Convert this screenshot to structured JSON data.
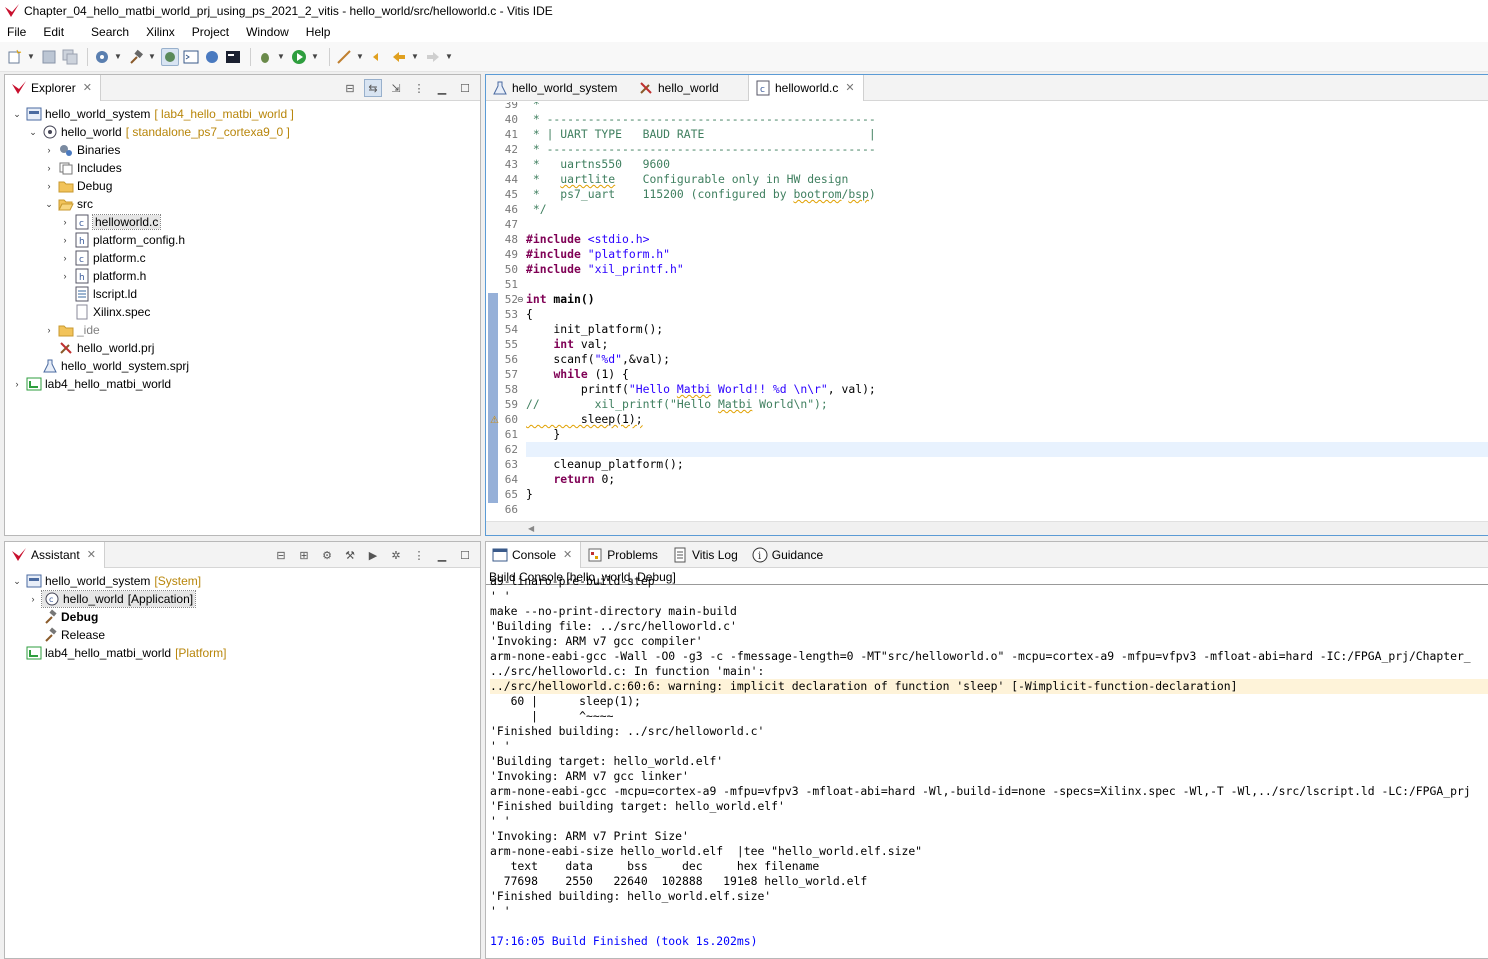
{
  "window": {
    "title": "Chapter_04_hello_matbi_world_prj_using_ps_2021_2_vitis - hello_world/src/helloworld.c - Vitis IDE"
  },
  "menu": [
    "File",
    "Edit",
    "Search",
    "Xilinx",
    "Project",
    "Window",
    "Help"
  ],
  "colors": {
    "accent": "#5b9bd5",
    "warning_bg": "#fef3d9",
    "comment": "#3f7f5f",
    "keyword": "#7f0055",
    "string": "#2a00ff",
    "deco_text": "#b8860b"
  },
  "explorer": {
    "tab_label": "Explorer",
    "items": [
      {
        "label": "hello_world_system",
        "deco": "[ lab4_hello_matbi_world ]",
        "icon": "system-project-icon"
      },
      {
        "label": "hello_world",
        "deco": "[ standalone_ps7_cortexa9_0 ]",
        "icon": "application-project-icon"
      },
      {
        "label": "Binaries",
        "icon": "binaries-icon"
      },
      {
        "label": "Includes",
        "icon": "includes-icon"
      },
      {
        "label": "Debug",
        "icon": "folder-icon"
      },
      {
        "label": "src",
        "icon": "folder-open-icon"
      },
      {
        "label": "helloworld.c",
        "icon": "c-file-icon"
      },
      {
        "label": "platform_config.h",
        "icon": "h-file-icon"
      },
      {
        "label": "platform.c",
        "icon": "c-file-icon"
      },
      {
        "label": "platform.h",
        "icon": "h-file-icon"
      },
      {
        "label": "lscript.ld",
        "icon": "linker-script-icon"
      },
      {
        "label": "Xilinx.spec",
        "icon": "file-icon"
      },
      {
        "label": "_ide",
        "icon": "folder-icon"
      },
      {
        "label": "hello_world.prj",
        "icon": "prj-file-icon"
      },
      {
        "label": "hello_world_system.sprj",
        "icon": "sprj-file-icon"
      },
      {
        "label": "lab4_hello_matbi_world",
        "icon": "platform-project-icon"
      }
    ]
  },
  "assistant": {
    "tab_label": "Assistant",
    "items": [
      {
        "label": "hello_world_system",
        "deco": "[System]"
      },
      {
        "label": "hello_world",
        "deco": "[Application]"
      },
      {
        "label": "Debug"
      },
      {
        "label": "Release"
      },
      {
        "label": "lab4_hello_matbi_world",
        "deco": "[Platform]"
      }
    ]
  },
  "editor": {
    "tabs": [
      "hello_world_system",
      "hello_world",
      "helloworld.c"
    ],
    "line_numbers": [
      "39",
      "40",
      "41",
      "42",
      "43",
      "44",
      "45",
      "46",
      "47",
      "48",
      "49",
      "50",
      "51",
      "52",
      "53",
      "54",
      "55",
      "56",
      "57",
      "58",
      "59",
      "60",
      "61",
      "62",
      "63",
      "64",
      "65",
      "66"
    ],
    "code": {
      "l39": " *",
      "l40_a": " * ",
      "l40_b": "------------------------------------------------",
      "l41_a": " * | UART TYPE   BAUD RATE                        |",
      "l42": " * ------------------------------------------------",
      "l43": " *   uartns550   9600",
      "l44_a": " *   ",
      "l44_b": "uartlite",
      "l44_c": "    Configurable only in HW design",
      "l45_a": " *   ps7_uart    115200 (configured by ",
      "l45_b": "bootrom",
      "l45_c": "/",
      "l45_d": "bsp",
      "l45_e": ")",
      "l46": " */",
      "l48_kw": "#include",
      "l48_s": " <stdio.h>",
      "l49_kw": "#include",
      "l49_s": " \"platform.h\"",
      "l50_kw": "#include",
      "l50_s": " \"xil_printf.h\"",
      "l52_kw": "int",
      "l52_rest": " main()",
      "l53": "{",
      "l54": "    init_platform();",
      "l55_i": "    ",
      "l55_kw": "int",
      "l55_rest": " val;",
      "l56_a": "    scanf(",
      "l56_s": "\"%d\"",
      "l56_b": ",&val);",
      "l57_i": "    ",
      "l57_kw": "while",
      "l57_rest": " (1) {",
      "l58_a": "        printf(",
      "l58_s1": "\"Hello ",
      "l58_w": "Matbi",
      "l58_s2": " World!! %d \\n\\r\"",
      "l58_b": ", val);",
      "l59_a": "//        xil_printf(\"Hello ",
      "l59_w": "Matbi",
      "l59_b": " World\\n\");",
      "l60": "        sleep(1);",
      "l61": "    }",
      "l63": "    cleanup_platform();",
      "l64_i": "    ",
      "l64_kw": "return",
      "l64_rest": " 0;",
      "l65": "}"
    }
  },
  "console": {
    "tabs": [
      "Console",
      "Problems",
      "Vitis Log",
      "Guidance"
    ],
    "title": "Build Console [hello_world, Debug]",
    "lines": [
      "a9-linaro-pre-build-step",
      "' '",
      "make --no-print-directory main-build",
      "'Building file: ../src/helloworld.c'",
      "'Invoking: ARM v7 gcc compiler'",
      "arm-none-eabi-gcc -Wall -O0 -g3 -c -fmessage-length=0 -MT\"src/helloworld.o\" -mcpu=cortex-a9 -mfpu=vfpv3 -mfloat-abi=hard -IC:/FPGA_prj/Chapter_",
      "../src/helloworld.c: In function 'main':",
      "../src/helloworld.c:60:6: warning: implicit declaration of function 'sleep' [-Wimplicit-function-declaration]",
      "   60 |      sleep(1);",
      "      |      ^~~~~",
      "'Finished building: ../src/helloworld.c'",
      "' '",
      "'Building target: hello_world.elf'",
      "'Invoking: ARM v7 gcc linker'",
      "arm-none-eabi-gcc -mcpu=cortex-a9 -mfpu=vfpv3 -mfloat-abi=hard -Wl,-build-id=none -specs=Xilinx.spec -Wl,-T -Wl,../src/lscript.ld -LC:/FPGA_prj",
      "'Finished building target: hello_world.elf'",
      "' '",
      "'Invoking: ARM v7 Print Size'",
      "arm-none-eabi-size hello_world.elf  |tee \"hello_world.elf.size\"",
      "   text    data     bss     dec     hex filename",
      "  77698    2550   22640  102888   191e8 hello_world.elf",
      "'Finished building: hello_world.elf.size'",
      "' '",
      "",
      "17:16:05 Build Finished (took 1s.202ms)"
    ]
  }
}
